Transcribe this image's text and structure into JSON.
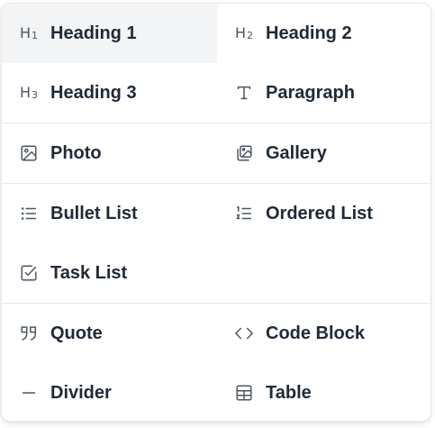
{
  "menu": {
    "headings": {
      "h1": "Heading 1",
      "h2": "Heading 2",
      "h3": "Heading 3",
      "paragraph": "Paragraph"
    },
    "media": {
      "photo": "Photo",
      "gallery": "Gallery"
    },
    "lists": {
      "bullet": "Bullet List",
      "ordered": "Ordered List",
      "task": "Task List"
    },
    "blocks": {
      "quote": "Quote",
      "code": "Code Block",
      "divider": "Divider",
      "table": "Table"
    }
  },
  "icons": {
    "h1": "H1",
    "h2": "H2",
    "h3": "H3"
  },
  "colors": {
    "active_background": "#f3f4f6",
    "label": "#1f2937",
    "icon": "#4b5563",
    "divider": "#e5e7eb"
  },
  "state": {
    "active_item": "heading-1"
  }
}
